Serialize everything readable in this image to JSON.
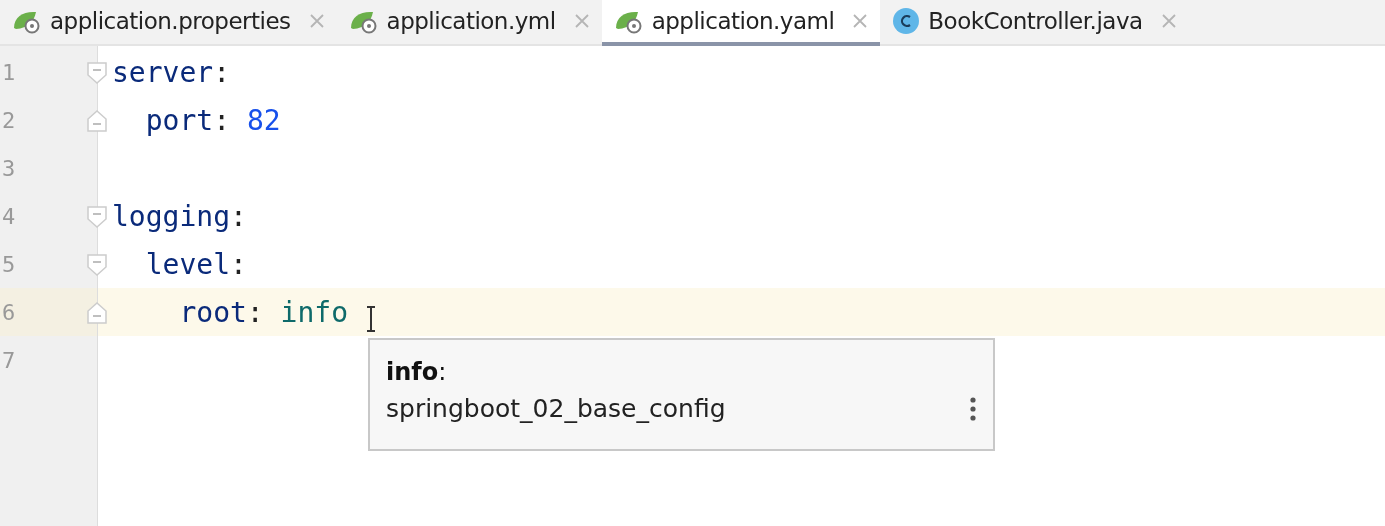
{
  "tabs": [
    {
      "label": "application.properties",
      "kind": "spring",
      "selected": false
    },
    {
      "label": "application.yml",
      "kind": "spring",
      "selected": false
    },
    {
      "label": "application.yaml",
      "kind": "spring",
      "selected": true
    },
    {
      "label": "BookController.java",
      "kind": "class",
      "selected": false
    }
  ],
  "lines": [
    {
      "number": "1",
      "kind": "opener",
      "current": false,
      "tokens": [
        {
          "text": "server",
          "kind": "key"
        },
        {
          "text": ":",
          "kind": "punct"
        }
      ]
    },
    {
      "number": "2",
      "kind": "closer",
      "current": false,
      "tokens": [
        {
          "text": "  port",
          "kind": "key"
        },
        {
          "text": ": ",
          "kind": "punct"
        },
        {
          "text": "82",
          "kind": "number"
        }
      ]
    },
    {
      "number": "3",
      "kind": "plain",
      "current": false
    },
    {
      "number": "4",
      "kind": "opener",
      "current": false,
      "tokens": [
        {
          "text": "logging",
          "kind": "key"
        },
        {
          "text": ":",
          "kind": "punct"
        }
      ]
    },
    {
      "number": "5",
      "kind": "opener",
      "current": false,
      "tokens": [
        {
          "text": "  level",
          "kind": "key"
        },
        {
          "text": ":",
          "kind": "punct"
        }
      ]
    },
    {
      "number": "6",
      "kind": "closer",
      "current": true,
      "tokens": [
        {
          "text": "    root",
          "kind": "key"
        },
        {
          "text": ": ",
          "kind": "punct"
        },
        {
          "text": "info",
          "kind": "value"
        }
      ]
    },
    {
      "number": "7",
      "kind": "plain",
      "current": false
    }
  ],
  "popup": {
    "title": "**info**:",
    "location": "springboot_02_base_config"
  }
}
